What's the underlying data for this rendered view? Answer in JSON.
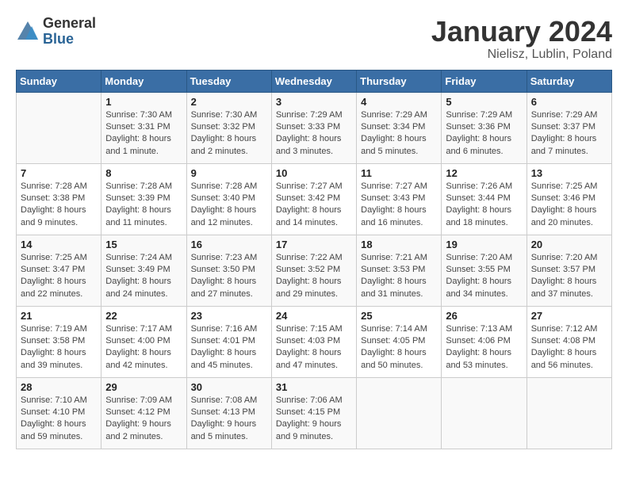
{
  "logo": {
    "general": "General",
    "blue": "Blue"
  },
  "title": "January 2024",
  "location": "Nielisz, Lublin, Poland",
  "days_header": [
    "Sunday",
    "Monday",
    "Tuesday",
    "Wednesday",
    "Thursday",
    "Friday",
    "Saturday"
  ],
  "weeks": [
    [
      {
        "num": "",
        "detail": ""
      },
      {
        "num": "1",
        "detail": "Sunrise: 7:30 AM\nSunset: 3:31 PM\nDaylight: 8 hours\nand 1 minute."
      },
      {
        "num": "2",
        "detail": "Sunrise: 7:30 AM\nSunset: 3:32 PM\nDaylight: 8 hours\nand 2 minutes."
      },
      {
        "num": "3",
        "detail": "Sunrise: 7:29 AM\nSunset: 3:33 PM\nDaylight: 8 hours\nand 3 minutes."
      },
      {
        "num": "4",
        "detail": "Sunrise: 7:29 AM\nSunset: 3:34 PM\nDaylight: 8 hours\nand 5 minutes."
      },
      {
        "num": "5",
        "detail": "Sunrise: 7:29 AM\nSunset: 3:36 PM\nDaylight: 8 hours\nand 6 minutes."
      },
      {
        "num": "6",
        "detail": "Sunrise: 7:29 AM\nSunset: 3:37 PM\nDaylight: 8 hours\nand 7 minutes."
      }
    ],
    [
      {
        "num": "7",
        "detail": "Sunrise: 7:28 AM\nSunset: 3:38 PM\nDaylight: 8 hours\nand 9 minutes."
      },
      {
        "num": "8",
        "detail": "Sunrise: 7:28 AM\nSunset: 3:39 PM\nDaylight: 8 hours\nand 11 minutes."
      },
      {
        "num": "9",
        "detail": "Sunrise: 7:28 AM\nSunset: 3:40 PM\nDaylight: 8 hours\nand 12 minutes."
      },
      {
        "num": "10",
        "detail": "Sunrise: 7:27 AM\nSunset: 3:42 PM\nDaylight: 8 hours\nand 14 minutes."
      },
      {
        "num": "11",
        "detail": "Sunrise: 7:27 AM\nSunset: 3:43 PM\nDaylight: 8 hours\nand 16 minutes."
      },
      {
        "num": "12",
        "detail": "Sunrise: 7:26 AM\nSunset: 3:44 PM\nDaylight: 8 hours\nand 18 minutes."
      },
      {
        "num": "13",
        "detail": "Sunrise: 7:25 AM\nSunset: 3:46 PM\nDaylight: 8 hours\nand 20 minutes."
      }
    ],
    [
      {
        "num": "14",
        "detail": "Sunrise: 7:25 AM\nSunset: 3:47 PM\nDaylight: 8 hours\nand 22 minutes."
      },
      {
        "num": "15",
        "detail": "Sunrise: 7:24 AM\nSunset: 3:49 PM\nDaylight: 8 hours\nand 24 minutes."
      },
      {
        "num": "16",
        "detail": "Sunrise: 7:23 AM\nSunset: 3:50 PM\nDaylight: 8 hours\nand 27 minutes."
      },
      {
        "num": "17",
        "detail": "Sunrise: 7:22 AM\nSunset: 3:52 PM\nDaylight: 8 hours\nand 29 minutes."
      },
      {
        "num": "18",
        "detail": "Sunrise: 7:21 AM\nSunset: 3:53 PM\nDaylight: 8 hours\nand 31 minutes."
      },
      {
        "num": "19",
        "detail": "Sunrise: 7:20 AM\nSunset: 3:55 PM\nDaylight: 8 hours\nand 34 minutes."
      },
      {
        "num": "20",
        "detail": "Sunrise: 7:20 AM\nSunset: 3:57 PM\nDaylight: 8 hours\nand 37 minutes."
      }
    ],
    [
      {
        "num": "21",
        "detail": "Sunrise: 7:19 AM\nSunset: 3:58 PM\nDaylight: 8 hours\nand 39 minutes."
      },
      {
        "num": "22",
        "detail": "Sunrise: 7:17 AM\nSunset: 4:00 PM\nDaylight: 8 hours\nand 42 minutes."
      },
      {
        "num": "23",
        "detail": "Sunrise: 7:16 AM\nSunset: 4:01 PM\nDaylight: 8 hours\nand 45 minutes."
      },
      {
        "num": "24",
        "detail": "Sunrise: 7:15 AM\nSunset: 4:03 PM\nDaylight: 8 hours\nand 47 minutes."
      },
      {
        "num": "25",
        "detail": "Sunrise: 7:14 AM\nSunset: 4:05 PM\nDaylight: 8 hours\nand 50 minutes."
      },
      {
        "num": "26",
        "detail": "Sunrise: 7:13 AM\nSunset: 4:06 PM\nDaylight: 8 hours\nand 53 minutes."
      },
      {
        "num": "27",
        "detail": "Sunrise: 7:12 AM\nSunset: 4:08 PM\nDaylight: 8 hours\nand 56 minutes."
      }
    ],
    [
      {
        "num": "28",
        "detail": "Sunrise: 7:10 AM\nSunset: 4:10 PM\nDaylight: 8 hours\nand 59 minutes."
      },
      {
        "num": "29",
        "detail": "Sunrise: 7:09 AM\nSunset: 4:12 PM\nDaylight: 9 hours\nand 2 minutes."
      },
      {
        "num": "30",
        "detail": "Sunrise: 7:08 AM\nSunset: 4:13 PM\nDaylight: 9 hours\nand 5 minutes."
      },
      {
        "num": "31",
        "detail": "Sunrise: 7:06 AM\nSunset: 4:15 PM\nDaylight: 9 hours\nand 9 minutes."
      },
      {
        "num": "",
        "detail": ""
      },
      {
        "num": "",
        "detail": ""
      },
      {
        "num": "",
        "detail": ""
      }
    ]
  ]
}
